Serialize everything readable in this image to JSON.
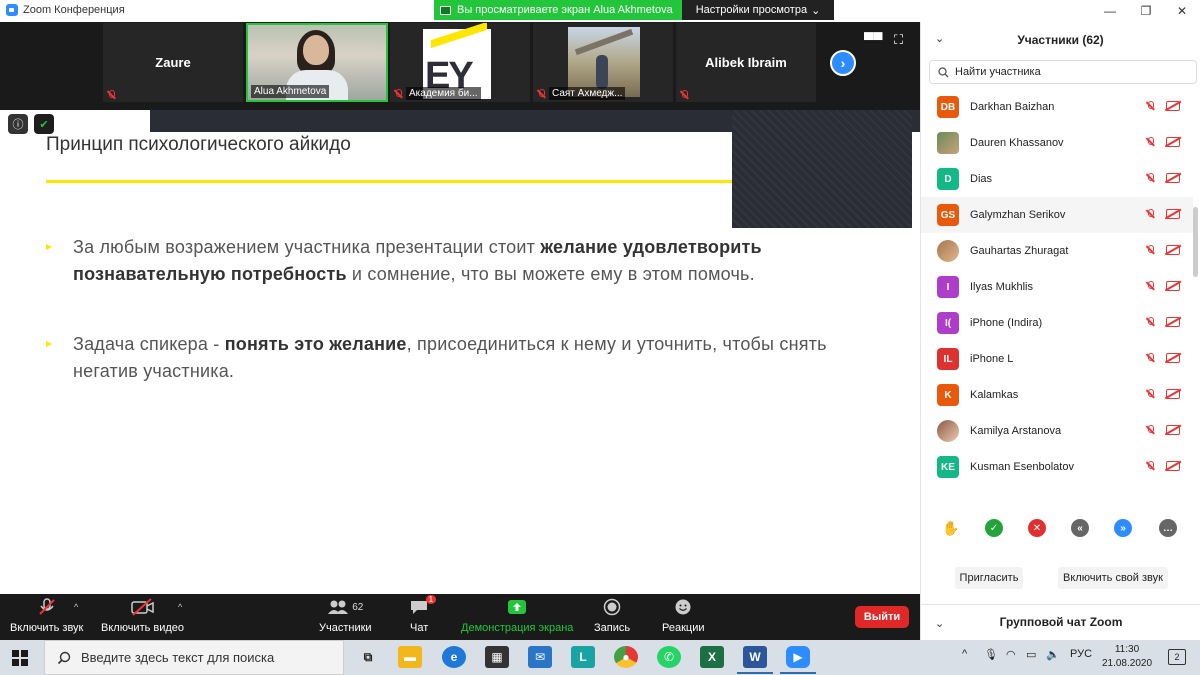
{
  "window": {
    "title": "Zoom Конференция",
    "share_banner": "Вы просматриваете экран Alua Akhmetova",
    "view_settings": "Настройки просмотра",
    "controls": [
      "—",
      "❐",
      "✕"
    ]
  },
  "strip": {
    "tiles": [
      {
        "name": "Zaure",
        "label": ""
      },
      {
        "name": "",
        "label": "Alua Akhmetova"
      },
      {
        "name": "",
        "label": "Академия би..."
      },
      {
        "name": "",
        "label": "Саят Ахмедж..."
      },
      {
        "name": "Alibek Ibraim",
        "label": ""
      }
    ],
    "next_icon": "›"
  },
  "slide": {
    "title": "Принцип психологического айкидо",
    "bullet1": {
      "part1": "За любым возражением участника презентации стоит ",
      "bold": "желание удовлетворить познавательную потребность",
      "part2": " и сомнение, что вы можете ему в этом помочь."
    },
    "bullet2": {
      "part1": "Задача спикера - ",
      "bold": "понять это желание",
      "part2": ", присоединиться к нему и уточнить, чтобы снять негатив участника."
    }
  },
  "toolbar": {
    "audio": "Включить звук",
    "video": "Включить видео",
    "participants": "Участники",
    "participants_count": "62",
    "chat": "Чат",
    "chat_badge": "1",
    "share": "Демонстрация экрана",
    "record": "Запись",
    "reactions": "Реакции",
    "leave": "Выйти"
  },
  "panel": {
    "title": "Участники (62)",
    "search_placeholder": "Найти участника",
    "participants": [
      {
        "initials": "DB",
        "name": "Darkhan Baizhan",
        "color": "#e8590c"
      },
      {
        "initials": "",
        "name": "Dauren Khassanov",
        "color": "photo"
      },
      {
        "initials": "D",
        "name": "Dias",
        "color": "#12b886"
      },
      {
        "initials": "GS",
        "name": "Galymzhan Serikov",
        "color": "#e8590c"
      },
      {
        "initials": "",
        "name": "Gauhartas Zhuragat",
        "color": "photo2"
      },
      {
        "initials": "I",
        "name": "Ilyas Mukhlis",
        "color": "#ae3ec9"
      },
      {
        "initials": "I(",
        "name": "iPhone (Indira)",
        "color": "#ae3ec9"
      },
      {
        "initials": "IL",
        "name": "iPhone L",
        "color": "#e03131"
      },
      {
        "initials": "K",
        "name": "Kalamkas",
        "color": "#e8590c"
      },
      {
        "initials": "",
        "name": "Kamilya Arstanova",
        "color": "photo3"
      },
      {
        "initials": "KE",
        "name": "Kusman Esenbolatov",
        "color": "#12b886"
      }
    ],
    "invite": "Пригласить",
    "unmute_me": "Включить свой звук",
    "group_chat": "Групповой чат Zoom"
  },
  "taskbar": {
    "search_placeholder": "Введите здесь текст для поиска",
    "language": "РУС",
    "time": "11:30",
    "date": "21.08.2020",
    "notifications": "2"
  },
  "colors": {
    "zoom_blue": "#2D8CFF",
    "share_green": "#23c63b",
    "leave_red": "#e02828",
    "slide_yellow": "#ffe600"
  }
}
